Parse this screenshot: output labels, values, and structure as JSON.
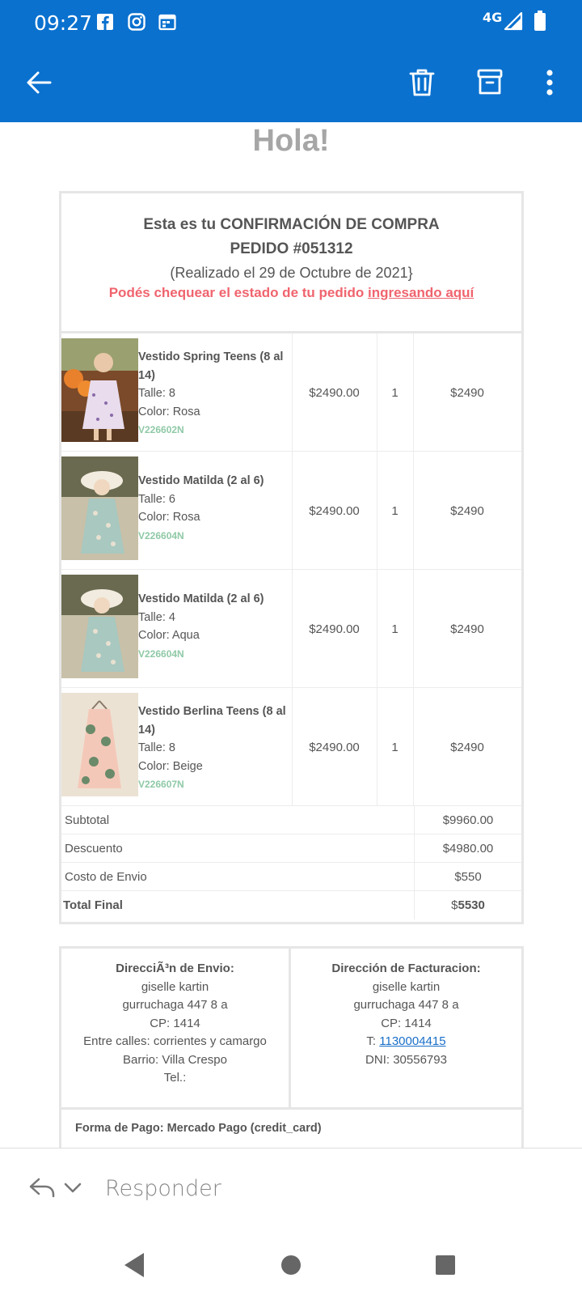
{
  "status_bar": {
    "time": "09:27",
    "network": "4G",
    "icons": [
      "facebook-icon",
      "instagram-icon",
      "calendar-icon",
      "signal-icon",
      "battery-icon"
    ]
  },
  "app_bar": {
    "color": "#0a71cf",
    "icons": [
      "back-arrow-icon",
      "trash-icon",
      "archive-icon",
      "more-vert-icon"
    ]
  },
  "email": {
    "greeting": "Hola!",
    "confirmation_title": "Esta es tu CONFIRMACIÓN DE COMPRA",
    "order_number": "PEDIDO #051312",
    "order_date": "(Realizado el 29 de Octubre de 2021}",
    "check_status_text": "Podés chequear el estado de tu pedido ",
    "check_status_link": "ingresando aquí",
    "products": [
      {
        "name": "Vestido Spring Teens (8 al 14)",
        "size": "Talle: 8",
        "color": "Color: Rosa",
        "sku": "V226602N",
        "price": "$2490.00",
        "qty": "1",
        "total": "$2490"
      },
      {
        "name": "Vestido Matilda (2 al 6)",
        "size": "Talle: 6",
        "color": "Color: Rosa",
        "sku": "V226604N",
        "price": "$2490.00",
        "qty": "1",
        "total": "$2490"
      },
      {
        "name": "Vestido Matilda (2 al 6)",
        "size": "Talle: 4",
        "color": "Color: Aqua",
        "sku": "V226604N",
        "price": "$2490.00",
        "qty": "1",
        "total": "$2490"
      },
      {
        "name": "Vestido Berlina Teens (8 al 14)",
        "size": "Talle: 8",
        "color": "Color: Beige",
        "sku": "V226607N",
        "price": "$2490.00",
        "qty": "1",
        "total": "$2490"
      }
    ],
    "totals": {
      "subtotal_label": "Subtotal",
      "subtotal": "$9960.00",
      "discount_label": "Descuento",
      "discount": "$4980.00",
      "shipping_label": "Costo de Envio",
      "shipping": "$550",
      "final_label": "Total Final",
      "final_currency": "$",
      "final": "5530"
    },
    "shipping_address": {
      "title": "DirecciÃ³n de Envio:",
      "name": "giselle kartin",
      "street": "gurruchaga 447 8 a",
      "cp": "CP: 1414",
      "between": "Entre calles: corrientes y camargo",
      "barrio": "Barrio: Villa Crespo",
      "tel": "Tel.:"
    },
    "billing_address": {
      "title": "Dirección de Facturacion:",
      "name": "giselle kartin",
      "street": "gurruchaga 447 8 a",
      "cp": "CP: 1414",
      "tel_prefix": "T: ",
      "tel": "1130004415",
      "dni": "DNI: 30556793"
    },
    "payment": "Forma de Pago: Mercado Pago (credit_card)"
  },
  "reply_bar": {
    "placeholder": "Responder",
    "icons": [
      "reply-icon",
      "chevron-down-icon"
    ]
  },
  "nav_bar": {
    "icons": [
      "back-triangle-icon",
      "home-circle-icon",
      "recents-square-icon"
    ]
  }
}
